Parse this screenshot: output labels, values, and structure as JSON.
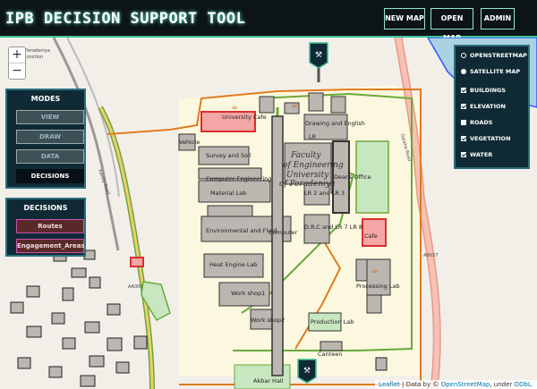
{
  "header": {
    "title": "IPB DECISION SUPPORT TOOL",
    "buttons": [
      "NEW MAP",
      "OPEN MAP",
      "ADMIN"
    ]
  },
  "zoom": {
    "in": "+",
    "out": "−"
  },
  "modes": {
    "title": "MODES",
    "items": [
      {
        "label": "VIEW",
        "active": false
      },
      {
        "label": "DRAW",
        "active": false
      },
      {
        "label": "DATA",
        "active": false
      },
      {
        "label": "DECISIONS",
        "active": true
      }
    ]
  },
  "decisions": {
    "title": "DECISIONS",
    "items": [
      "Routes",
      "Engagement_Areas"
    ]
  },
  "layers": {
    "base": [
      {
        "label": "OPENSTREETMAP",
        "selected": true
      },
      {
        "label": "SATELLITE MAP",
        "selected": false
      }
    ],
    "overlays": [
      {
        "label": "BUILDINGS",
        "checked": true
      },
      {
        "label": "ELEVATION",
        "checked": true
      },
      {
        "label": "ROADS",
        "checked": false
      },
      {
        "label": "VEGETATION",
        "checked": true
      },
      {
        "label": "WATER",
        "checked": true
      }
    ]
  },
  "attribution": {
    "leaflet": "Leaflet",
    "sep1": " | Data by © ",
    "osm": "OpenStreetMap",
    "sep2": ", under ",
    "odbl": "ODbL."
  },
  "map_labels": {
    "peradeniya_junction_1": "Peradeniya",
    "peradeniya_junction_2": "Junction",
    "faculty": "Faculty",
    "faculty2": "of Engineering",
    "faculty3": "University",
    "faculty4": "of Peradeniya",
    "university_cafe": "University Cafe",
    "survey_soil": "Survey and Soil",
    "computer_eng": "Computer Engineering",
    "material_lab": "Material Lab",
    "environmental": "Environmental and Fluid",
    "computer": "Computer",
    "heat_engine": "Heat Engine Lab",
    "workshop1": "Work shop1",
    "workshop2": "Work shop2",
    "vehicle": "Vehicle",
    "drawing": "Drawing and English",
    "lr": "LR",
    "deans": "Deans Office",
    "lr2": "LR 2 and LR 3",
    "drc": "D.R.C and LR 7 LR 8",
    "cafe_lab": "Cafe",
    "processing_lab": "Processing Lab",
    "production_lab": "Production Lab",
    "canteen": "Canteen",
    "akbar_hall": "Akbar Hall",
    "road_ab037": "AB037",
    "road_ab05": "AA005",
    "kandy_road": "Kandy Road",
    "galaha_road": "Galaha Road"
  },
  "colors": {
    "accent": "#3fbf9a",
    "header_bg": "#0c1418",
    "panel_bg": "#0f2a35",
    "route_orange": "#e07b1f",
    "route_green": "#6aa83a",
    "road_red": "#e8988a"
  }
}
